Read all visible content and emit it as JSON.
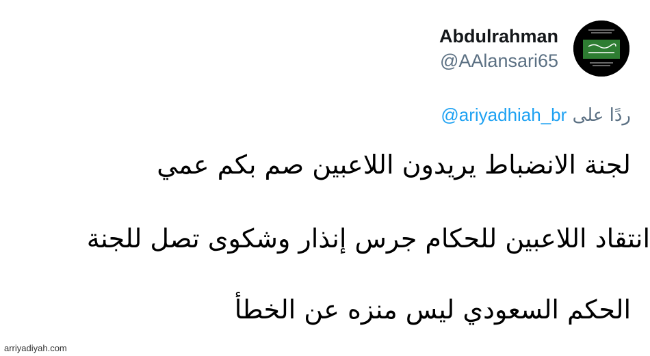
{
  "tweet": {
    "author": {
      "display_name": "Abdulrahman",
      "handle": "@AAlansari65",
      "avatar_icon": "saudi-flag-avatar-icon"
    },
    "reply": {
      "prefix": "ردًا على",
      "mention": "@ariyadhiah_br"
    },
    "body_lines": [
      "لجنة الانضباط يريدون اللاعبين صم بكم عمي",
      "انتقاد اللاعبين للحكام جرس إنذار وشكوى تصل للجنة",
      "الحكم السعودي ليس منزه عن الخطأ"
    ]
  },
  "watermark": "arriyadiyah.com",
  "colors": {
    "mention": "#1da1f2",
    "secondary_text": "#5b7083",
    "avatar_green": "#2e7d32"
  }
}
